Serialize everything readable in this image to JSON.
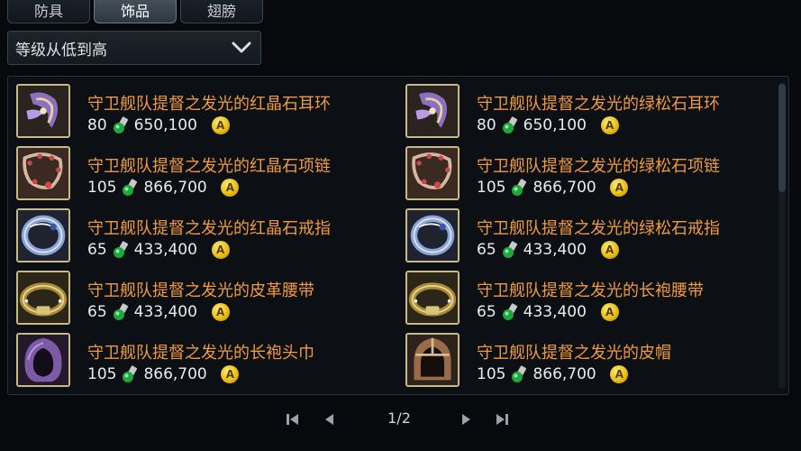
{
  "tabs": [
    {
      "label": "防具",
      "active": false
    },
    {
      "label": "饰品",
      "active": true
    },
    {
      "label": "翅膀",
      "active": false
    }
  ],
  "sort": {
    "label": "等级从低到高",
    "icon": "chevron-down-icon"
  },
  "items": [
    {
      "name": "守卫舰队提督之发光的红晶石耳环",
      "level": "80",
      "price": "650,100",
      "icon": "purple-earring-icon"
    },
    {
      "name": "守卫舰队提督之发光的绿松石耳环",
      "level": "80",
      "price": "650,100",
      "icon": "purple-earring-icon"
    },
    {
      "name": "守卫舰队提督之发光的红晶石项链",
      "level": "105",
      "price": "866,700",
      "icon": "red-necklace-icon"
    },
    {
      "name": "守卫舰队提督之发光的绿松石项链",
      "level": "105",
      "price": "866,700",
      "icon": "red-necklace-icon"
    },
    {
      "name": "守卫舰队提督之发光的红晶石戒指",
      "level": "65",
      "price": "433,400",
      "icon": "blue-ring-icon"
    },
    {
      "name": "守卫舰队提督之发光的绿松石戒指",
      "level": "65",
      "price": "433,400",
      "icon": "blue-ring-icon"
    },
    {
      "name": "守卫舰队提督之发光的皮革腰带",
      "level": "65",
      "price": "433,400",
      "icon": "gold-belt-icon"
    },
    {
      "name": "守卫舰队提督之发光的长袍腰带",
      "level": "65",
      "price": "433,400",
      "icon": "gold-belt-icon"
    },
    {
      "name": "守卫舰队提督之发光的长袍头巾",
      "level": "105",
      "price": "866,700",
      "icon": "purple-hood-icon"
    },
    {
      "name": "守卫舰队提督之发光的皮帽",
      "level": "105",
      "price": "866,700",
      "icon": "leather-helm-icon"
    }
  ],
  "currency": {
    "symbol": "A",
    "icon": "gold-coin-icon",
    "kinah_icon": "green-gem-icon"
  },
  "pager": {
    "indicator": "1/2"
  },
  "colors": {
    "item_name": "#f09a3c",
    "background": "#07090c",
    "panel": "#0c1014",
    "icon_border": "#c8b986"
  }
}
